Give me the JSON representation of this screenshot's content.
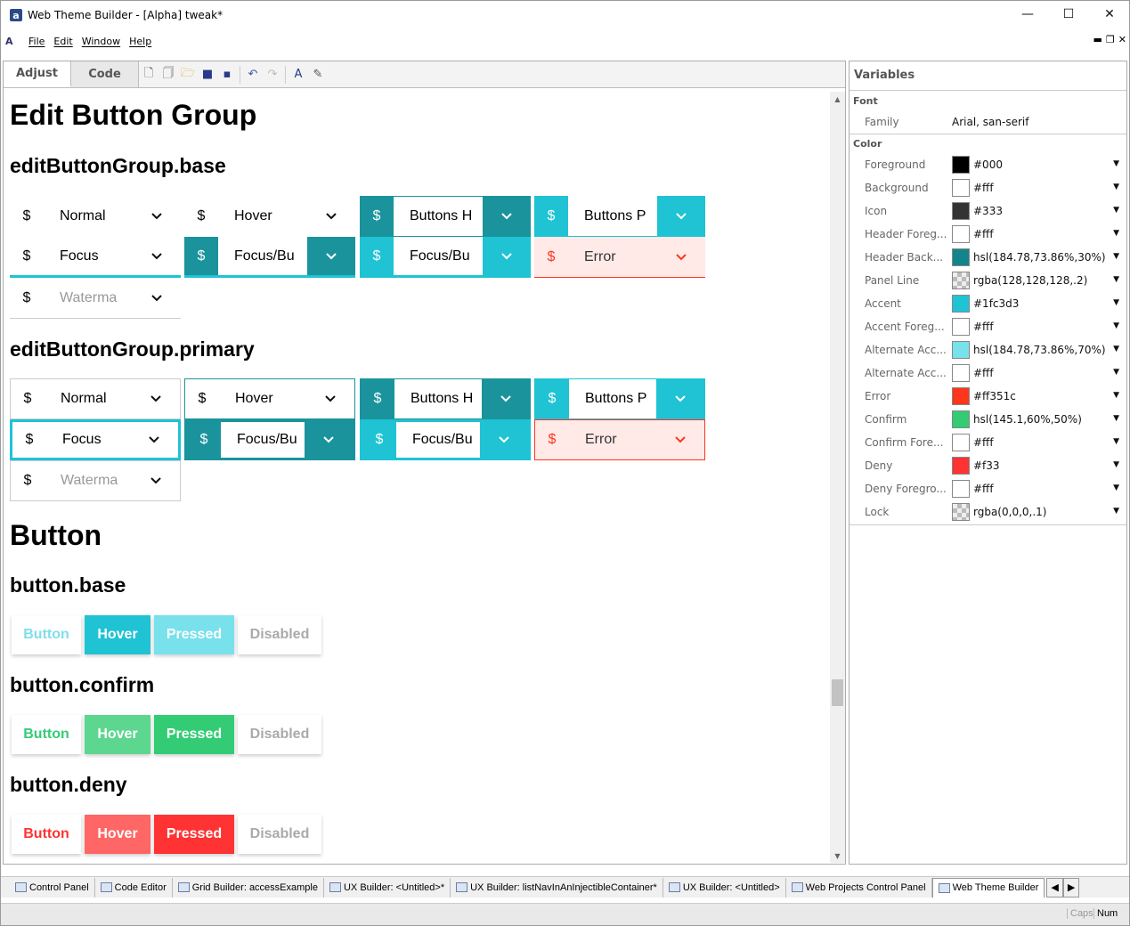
{
  "window": {
    "title": "Web Theme Builder - [Alpha] tweak*",
    "min": "—",
    "max": "☐",
    "close": "✕"
  },
  "menu": {
    "items": [
      "File",
      "Edit",
      "Window",
      "Help"
    ],
    "mdi_controls": [
      "▬",
      "❐",
      "✕"
    ]
  },
  "tabs": {
    "adjust": "Adjust",
    "code": "Code"
  },
  "content": {
    "h_edit_button_group": "Edit Button Group",
    "h_ebg_base": "editButtonGroup.base",
    "h_ebg_primary": "editButtonGroup.primary",
    "h_button": "Button",
    "h_button_base": "button.base",
    "h_button_confirm": "button.confirm",
    "h_button_deny": "button.deny",
    "currency": "$",
    "ebg_labels": {
      "normal": "Normal",
      "hover": "Hover",
      "buttons_hover": "Buttons H",
      "buttons_pressed": "Buttons P",
      "focus": "Focus",
      "focus_buttons_hover": "Focus/Bu",
      "focus_buttons_pressed": "Focus/Bu",
      "error": "Error",
      "watermark": "Waterma"
    },
    "button_labels": {
      "button": "Button",
      "hover": "Hover",
      "pressed": "Pressed",
      "disabled": "Disabled"
    }
  },
  "variables": {
    "title": "Variables",
    "font_category": "Font",
    "font_family_label": "Family",
    "font_family_value": "Arial, san-serif",
    "color_category": "Color",
    "colors": [
      {
        "label": "Foreground",
        "value": "#000",
        "swatch": "#000000"
      },
      {
        "label": "Background",
        "value": "#fff",
        "swatch": "#ffffff"
      },
      {
        "label": "Icon",
        "value": "#333",
        "swatch": "#333333"
      },
      {
        "label": "Header Foreg...",
        "value": "#fff",
        "swatch": "#ffffff"
      },
      {
        "label": "Header Back...",
        "value": "hsl(184.78,73.86%,30%)",
        "swatch": "#14848c"
      },
      {
        "label": "Panel Line",
        "value": "rgba(128,128,128,.2)",
        "swatch": "checker"
      },
      {
        "label": "Accent",
        "value": "#1fc3d3",
        "swatch": "#1fc3d3"
      },
      {
        "label": "Accent Foreg...",
        "value": "#fff",
        "swatch": "#ffffff"
      },
      {
        "label": "Alternate Acc...",
        "value": "hsl(184.78,73.86%,70%)",
        "swatch": "#78e1eb"
      },
      {
        "label": "Alternate Acc...",
        "value": "#fff",
        "swatch": "#ffffff"
      },
      {
        "label": "Error",
        "value": "#ff351c",
        "swatch": "#ff351c"
      },
      {
        "label": "Confirm",
        "value": "hsl(145.1,60%,50%)",
        "swatch": "#33cc75"
      },
      {
        "label": "Confirm Fore...",
        "value": "#fff",
        "swatch": "#ffffff"
      },
      {
        "label": "Deny",
        "value": "#f33",
        "swatch": "#ff3333"
      },
      {
        "label": "Deny Foregro...",
        "value": "#fff",
        "swatch": "#ffffff"
      },
      {
        "label": "Lock",
        "value": "rgba(0,0,0,.1)",
        "swatch": "checker"
      }
    ]
  },
  "taskbar": {
    "tabs": [
      "Control Panel",
      "Code Editor",
      "Grid Builder: accessExample",
      "UX Builder: <Untitled>*",
      "UX Builder: listNavInAnInjectibleContainer*",
      "UX Builder: <Untitled>",
      "Web Projects Control Panel",
      "Web Theme Builder"
    ],
    "active_index": 7
  },
  "status": {
    "caps": "Caps",
    "num": "Num"
  },
  "theme": {
    "accent": "#1fc3d3",
    "header_back": "#1a939c",
    "error": "#ff351c",
    "confirm": "#33cc75",
    "deny": "#ff3333"
  }
}
